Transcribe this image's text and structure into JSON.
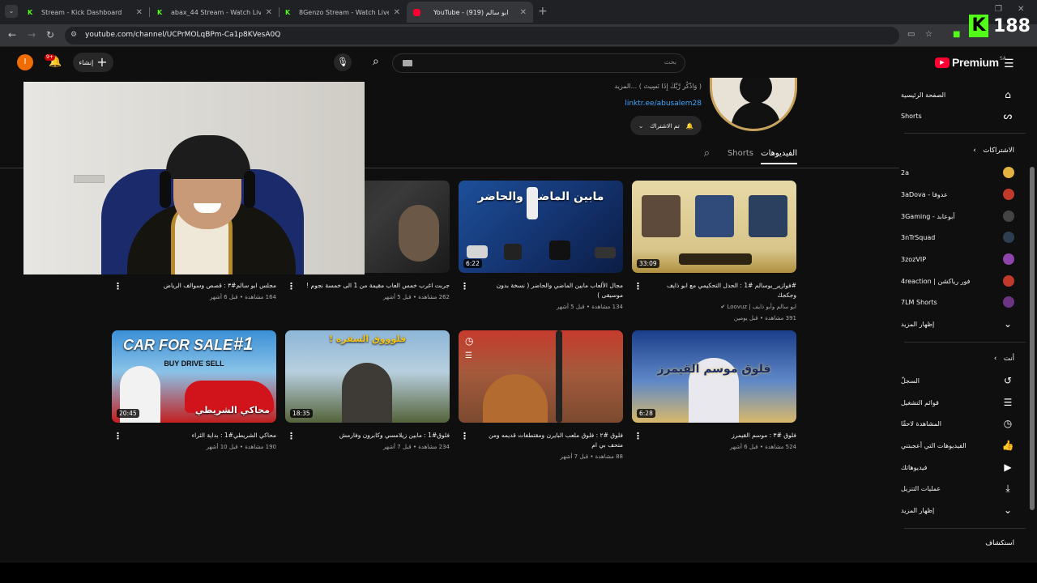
{
  "browser": {
    "tabs": [
      {
        "title": "Stream - Kick Dashboard",
        "icon": "kick-icon",
        "active": false
      },
      {
        "title": "abax_44 Stream - Watch Live on",
        "icon": "kick-icon",
        "active": false
      },
      {
        "title": "8Genzo Stream - Watch Live on",
        "icon": "kick-icon",
        "active": false
      },
      {
        "title": "YouTube - ابو سالم (919)",
        "icon": "youtube-icon",
        "active": true
      }
    ],
    "url": "youtube.com/channel/UCPrMOLqBPm-Ca1p8KVesA0Q",
    "kick_badge": "K",
    "kick_count": "188"
  },
  "header": {
    "logo_text": "Premium",
    "region": "SA",
    "search_placeholder": "بحث",
    "create_label": "إنشاء",
    "notification_count": "9+",
    "avatar_letter": "I"
  },
  "channel": {
    "description": "( وَاذْكُر رَّبَّكَ إِذَا نَسِيتَ ) ...المزيد",
    "link": "linktr.ee/abusalem28",
    "subscribe_label": "تم الاشتراك",
    "tabs": {
      "videos": "الفيديوهات",
      "shorts": "Shorts"
    }
  },
  "videos": [
    {
      "title": "#فوازير_بوسالم #1 : الحدل التحكيمي مع ابو ذايف وجكجك",
      "channel": "ابو سالم وأبو ذايف | Loovuz",
      "views": "391 مشاهدة",
      "age": "قبل يومين",
      "duration": "33:09",
      "overlay": "فوازير ابو سالم"
    },
    {
      "title": "مجال الألعاب مابين الماضي والحاضر ( نسخة بدون موسيقى )",
      "views": "134 مشاهدة",
      "age": "قبل 5 أشهر",
      "duration": "6:22",
      "overlay": "مابين الماضي والحاضر"
    },
    {
      "title": "جربت اغرب خمس العاب مقيمة من 1 الى خمسة نجوم !",
      "views": "262 مشاهدة",
      "age": "قبل 5 أشهر",
      "duration": "",
      "overlay": "هل"
    },
    {
      "title": "مجلس ابو سالم#٣ : قصص وسوالف الرياض",
      "views": "164 مشاهدة",
      "age": "قبل 6 أشهر",
      "duration": "",
      "overlay": ""
    },
    {
      "title": "فلوق #٣ : موسم القيمرز",
      "views": "524 مشاهدة",
      "age": "قبل 6 أشهر",
      "duration": "6:28",
      "overlay": "فلوق موسم القيمرز"
    },
    {
      "title": "فلوق #٢ : فلوق ملعب البايرن ومقتطفات قديمه ومن متحف بي ام",
      "views": "88 مشاهدة",
      "age": "قبل 7 أشهر",
      "duration": "",
      "overlay": ""
    },
    {
      "title": "فلوق#1 : مابين زيلامسي وكابرون وفارمش",
      "views": "234 مشاهدة",
      "age": "قبل 7 أشهر",
      "duration": "18:35",
      "overlay": "فلوووق السفره !"
    },
    {
      "title": "محاكي الشريطي#1 : بداية الثراء",
      "views": "190 مشاهدة",
      "age": "قبل 10 أشهر",
      "duration": "20:45",
      "overlay": "CAR FOR SALE",
      "overlay_sub": "BUY DRIVE SELL",
      "overlay_tag": "محاكي الشريطي",
      "overlay_num": "#1"
    }
  ],
  "sidebar": {
    "home": "الصفحة الرئيسية",
    "shorts": "Shorts",
    "subscriptions_title": "الاشتراكات",
    "subscriptions": [
      {
        "name": "2a",
        "color": "#e3b341"
      },
      {
        "name": "3aDova - عدوفا",
        "color": "#c0392b"
      },
      {
        "name": "3Gaming - أبوعابد",
        "color": "#444444"
      },
      {
        "name": "3nTrSquad",
        "color": "#2c3e50"
      },
      {
        "name": "3zozVIP",
        "color": "#8e44ad"
      },
      {
        "name": "4reaction | فور رياكشن",
        "color": "#c0392b"
      },
      {
        "name": "7LM Shorts",
        "color": "#6c3483"
      }
    ],
    "show_more": "إظهار المزيد",
    "you_title": "أنت",
    "you_items": [
      {
        "label": "السجلّ",
        "icon": "history-icon",
        "glyph": "↺"
      },
      {
        "label": "قوائم التشغيل",
        "icon": "playlist-icon",
        "glyph": "☰"
      },
      {
        "label": "المشاهدة لاحقًا",
        "icon": "clock-icon",
        "glyph": "◷"
      },
      {
        "label": "الفيديوهات التي أعجبتني",
        "icon": "like-icon",
        "glyph": "👍"
      },
      {
        "label": "فيديوهاتك",
        "icon": "your-videos-icon",
        "glyph": "▶"
      },
      {
        "label": "عمليات التنزيل",
        "icon": "download-icon",
        "glyph": "⤓"
      }
    ],
    "show_more_2": "إظهار المزيد",
    "explore_title": "استكشاف"
  }
}
